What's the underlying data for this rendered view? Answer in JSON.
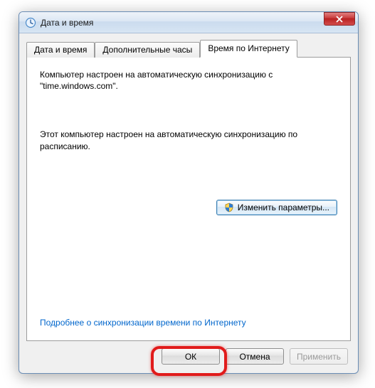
{
  "window": {
    "title": "Дата и время"
  },
  "tabs": {
    "items": [
      {
        "label": "Дата и время"
      },
      {
        "label": "Дополнительные часы"
      },
      {
        "label": "Время по Интернету"
      }
    ],
    "active_index": 2
  },
  "panel": {
    "sync_text": "Компьютер настроен на автоматическую синхронизацию с \"time.windows.com\".",
    "schedule_text": "Этот компьютер настроен на автоматическую синхронизацию по расписанию.",
    "change_button": "Изменить параметры...",
    "help_link": "Подробнее о синхронизации времени по Интернету"
  },
  "buttons": {
    "ok": "ОК",
    "cancel": "Отмена",
    "apply": "Применить"
  }
}
